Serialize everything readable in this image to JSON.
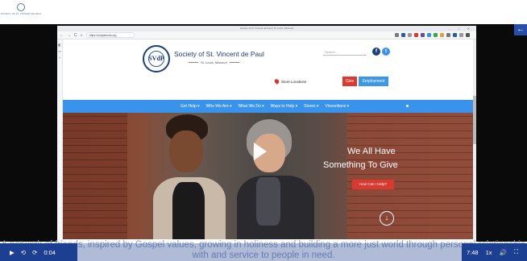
{
  "corner_logo": {
    "text": "SOCIETY OF ST. VINCENT DE PAUL"
  },
  "browser": {
    "tab_title": "Society of St. Vincent de Paul | St. Louis, Missouri",
    "url": "https://svdpstlouis.org",
    "nav_icons": [
      "←",
      "→",
      "C",
      "⌂"
    ]
  },
  "site": {
    "logo_letters": "SVdP",
    "name": "Society of St. Vincent de Paul",
    "location": "St. Louis, Missouri",
    "search_placeholder": "Search...",
    "store_locations": "Store Locations",
    "give_label": "Give",
    "employment_label": "Employment",
    "nav_items": [
      "Get Help ▾",
      "Who We Are ▾",
      "What We Do ▾",
      "Ways to Help ▾",
      "Stores ▾",
      "Vincentians ▾"
    ],
    "hero_line1": "We All Have",
    "hero_line2": "Something To Give",
    "hero_button": "How Can I Help?",
    "tagline": "A network of friends, inspired by Gospel values, growing in holiness and building a more just world through personal relationship with and service to people in need."
  },
  "player": {
    "current_time": "0:04",
    "duration": "7:48",
    "speed": "1x"
  },
  "colors": {
    "nav_blue": "#3a93ea",
    "give_red": "#d9392f",
    "player_blue": "#1c3f92"
  }
}
